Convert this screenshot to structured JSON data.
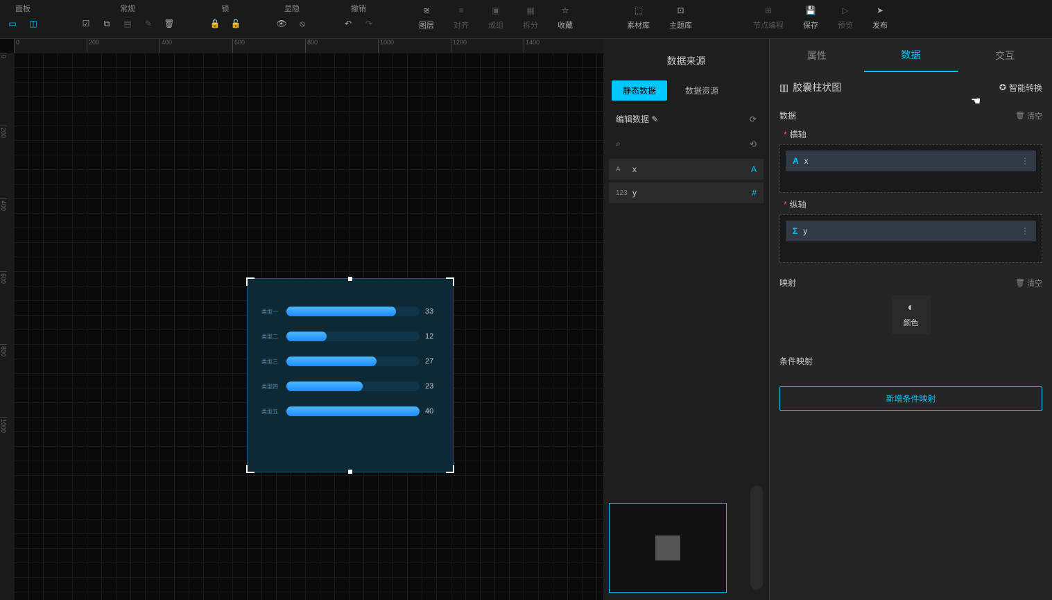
{
  "toolbar": {
    "groups": {
      "panel": "面板",
      "normal": "常规",
      "lock": "锁",
      "showHide": "显隐",
      "undo": "撤销"
    },
    "items": {
      "layer": "图层",
      "align": "对齐",
      "group": "成组",
      "split": "拆分",
      "favorite": "收藏",
      "materialLib": "素材库",
      "themeLib": "主题库",
      "nodeEdit": "节点编程",
      "save": "保存",
      "preview": "预览",
      "publish": "发布"
    }
  },
  "ruler_h": [
    "0",
    "200",
    "400",
    "600",
    "800",
    "1000",
    "1200",
    "1400"
  ],
  "ruler_v": [
    "0",
    "200",
    "400",
    "600",
    "800",
    "1000"
  ],
  "chart_data": {
    "type": "bar",
    "orientation": "horizontal",
    "categories": [
      "类型一",
      "类型二",
      "类型三",
      "类型四",
      "类型五"
    ],
    "values": [
      33,
      12,
      27,
      23,
      40
    ],
    "max": 40
  },
  "dataSource": {
    "title": "数据来源",
    "tabs": {
      "static": "静态数据",
      "resource": "数据资源"
    },
    "editData": "编辑数据",
    "fields": [
      {
        "type": "A",
        "name": "x",
        "endIcon": "A"
      },
      {
        "type": "123",
        "name": "y",
        "endIcon": "#"
      }
    ]
  },
  "propPanel": {
    "tabs": {
      "attr": "属性",
      "data": "数据",
      "interact": "交互"
    },
    "chartTitle": "胶囊柱状图",
    "smartConvert": "智能转换",
    "dataSection": "数据",
    "clear": "清空",
    "xAxis": "横轴",
    "yAxis": "纵轴",
    "xField": "x",
    "yField": "y",
    "mapping": "映射",
    "color": "颜色",
    "condMapping": "条件映射",
    "addCond": "新增条件映射"
  }
}
